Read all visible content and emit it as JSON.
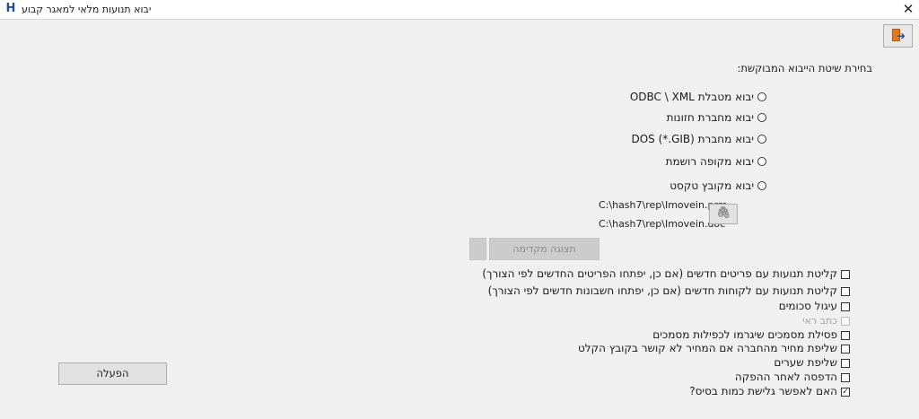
{
  "window": {
    "title": "יבוא תנועות מלאי למאגר קבוע",
    "app_icon_glyph": "H",
    "close_glyph": "✕"
  },
  "toolbar": {
    "exit_icon": "exit-door-icon",
    "exit_arrow": "➜"
  },
  "import_method": {
    "heading": "בחירת שיטת הייבוא המבוקשת:",
    "options": [
      {
        "label": "יבוא מטבלת ODBC \\ XML",
        "selected": false
      },
      {
        "label": "יבוא מחברת חזונות",
        "selected": false
      },
      {
        "label": "יבוא מחברת DOS (*.GIB)",
        "selected": false
      },
      {
        "label": "יבוא מקופה רושמת",
        "selected": false
      },
      {
        "label": "יבוא מקובץ טקסט",
        "selected": false
      }
    ]
  },
  "files": {
    "prm_path": "C:\\hash7\\rep\\Imovein.prm",
    "doc_path": "C:\\hash7\\rep\\Imovein.doc",
    "attach_icon": "paperclip-icon",
    "attach_glyph": "🖇"
  },
  "preview": {
    "label": "תצוגה מקדימה",
    "enabled": false
  },
  "options": [
    {
      "label": "קליטת תנועות עם פריטים חדשים (אם כן, יפתחו הפריטים החדשים לפי הצורך)",
      "checked": false,
      "disabled": false
    },
    {
      "label": "קליטת תנועות עם לקוחות חדשים (אם כן, יפתחו חשבונות חדשים לפי הצורך)",
      "checked": false,
      "disabled": false
    },
    {
      "label": "עיגול סכומים",
      "checked": false,
      "disabled": false
    },
    {
      "label": "כתב ראי",
      "checked": false,
      "disabled": true
    },
    {
      "label": "פסילת מסמכים שיגרמו לכפילות מסמכים",
      "checked": false,
      "disabled": false
    },
    {
      "label": "שליפת מחיר מהחברה אם המחיר לא קושר בקובץ הקלט",
      "checked": false,
      "disabled": false
    },
    {
      "label": "שליפת שערים",
      "checked": false,
      "disabled": false
    },
    {
      "label": "הדפסה לאחר ההפקה",
      "checked": false,
      "disabled": false
    },
    {
      "label": "האם לאפשר גלישת כמות בסיס?",
      "checked": true,
      "disabled": false
    }
  ],
  "actions": {
    "run_label": "הפעלה"
  }
}
